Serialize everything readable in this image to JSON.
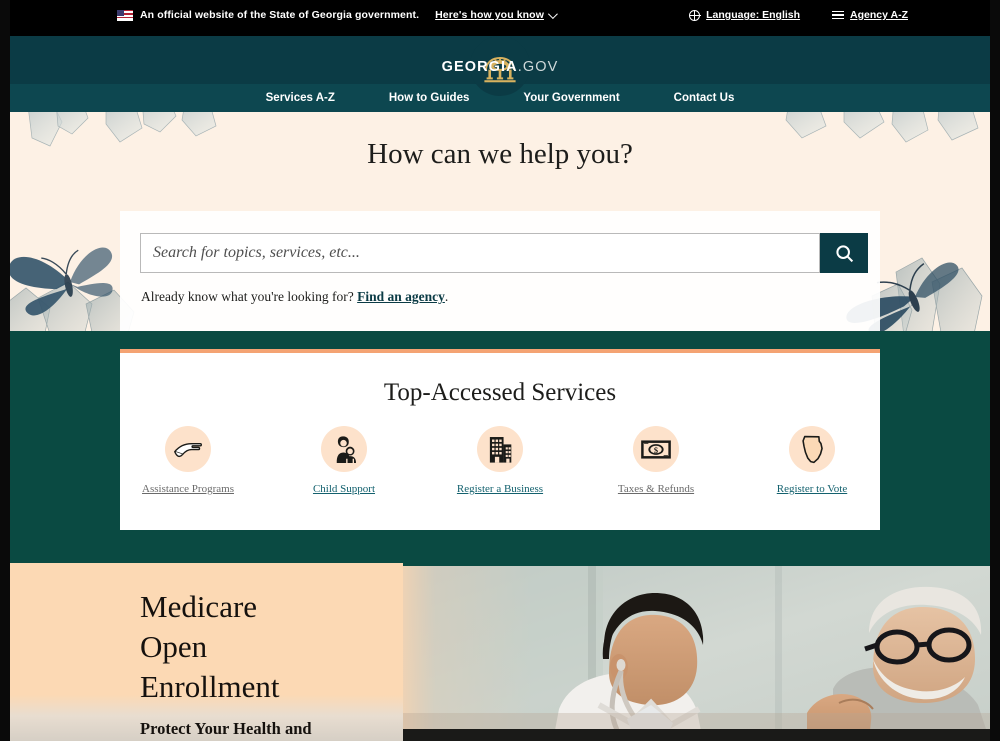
{
  "colors": {
    "util_bar_bg": "#000000",
    "header_teal": "#0b3b45",
    "nav_teal": "#0d4750",
    "section_teal": "#0a4a42",
    "hero_cream": "#fdf1e5",
    "card_accent_orange": "#f4a373",
    "icon_circle_peach": "#fde2cb",
    "link_teal": "#13616e",
    "banner_peach": "#fcd9b4"
  },
  "utility_bar": {
    "flag_icon": "us-flag-icon",
    "official_text": "An official website of the State of Georgia government.",
    "how_you_know_label": "Here's how you know",
    "chevron_icon": "chevron-down-icon",
    "globe_icon": "globe-icon",
    "language_label": "Language: English",
    "list_icon": "list-icon",
    "agency_label": "Agency A-Z"
  },
  "header": {
    "logo_icon": "georgia-capitol-arch-logo-icon",
    "brand_primary": "GEORGIA",
    "brand_secondary": ".GOV"
  },
  "nav": {
    "items": [
      {
        "label": "Services A-Z"
      },
      {
        "label": "How to Guides"
      },
      {
        "label": "Your Government"
      },
      {
        "label": "Contact Us"
      }
    ]
  },
  "hero": {
    "title": "How can we help you?",
    "search_placeholder": "Search for topics, services, etc...",
    "search_value": "",
    "search_button_icon": "search-icon",
    "subtext_prefix": "Already know what you're looking for? ",
    "subtext_link": "Find an agency",
    "subtext_suffix": ".",
    "background_art": "butterfly-and-quartz-crystal-illustration"
  },
  "services": {
    "title": "Top-Accessed Services",
    "items": [
      {
        "label": "Assistance Programs",
        "icon": "helping-hand-icon",
        "state": "visited"
      },
      {
        "label": "Child Support",
        "icon": "parent-and-child-icon",
        "state": "default"
      },
      {
        "label": "Register a Business",
        "icon": "office-building-icon",
        "state": "default"
      },
      {
        "label": "Taxes & Refunds",
        "icon": "dollar-bill-icon",
        "state": "visited"
      },
      {
        "label": "Register to Vote",
        "icon": "georgia-state-outline-icon",
        "state": "default"
      }
    ]
  },
  "banner": {
    "title_line1": "Medicare",
    "title_line2": "Open",
    "title_line3": "Enrollment",
    "subtitle": "Protect Your Health and",
    "photo_alt": "doctor-with-stethoscope-speaking-with-elderly-patient"
  }
}
